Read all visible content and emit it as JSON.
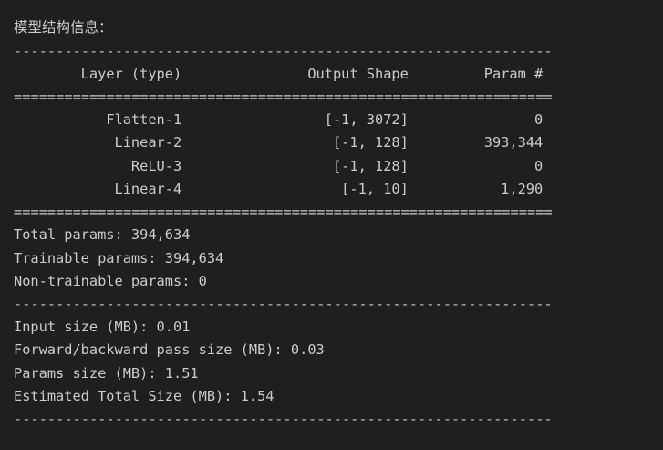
{
  "heading": "模型结构信息：",
  "rules": {
    "dash": "----------------------------------------------------------------",
    "equals": "================================================================"
  },
  "table": {
    "header": "        Layer (type)               Output Shape         Param #",
    "rows": [
      "           Flatten-1                 [-1, 3072]               0",
      "            Linear-2                  [-1, 128]         393,344",
      "              ReLU-3                  [-1, 128]               0",
      "            Linear-4                   [-1, 10]           1,290"
    ]
  },
  "params": {
    "total": "Total params: 394,634",
    "trainable": "Trainable params: 394,634",
    "non_trainable": "Non-trainable params: 0"
  },
  "sizes": {
    "input": "Input size (MB): 0.01",
    "forward_backward": "Forward/backward pass size (MB): 0.03",
    "params": "Params size (MB): 1.51",
    "estimated_total": "Estimated Total Size (MB): 1.54"
  }
}
